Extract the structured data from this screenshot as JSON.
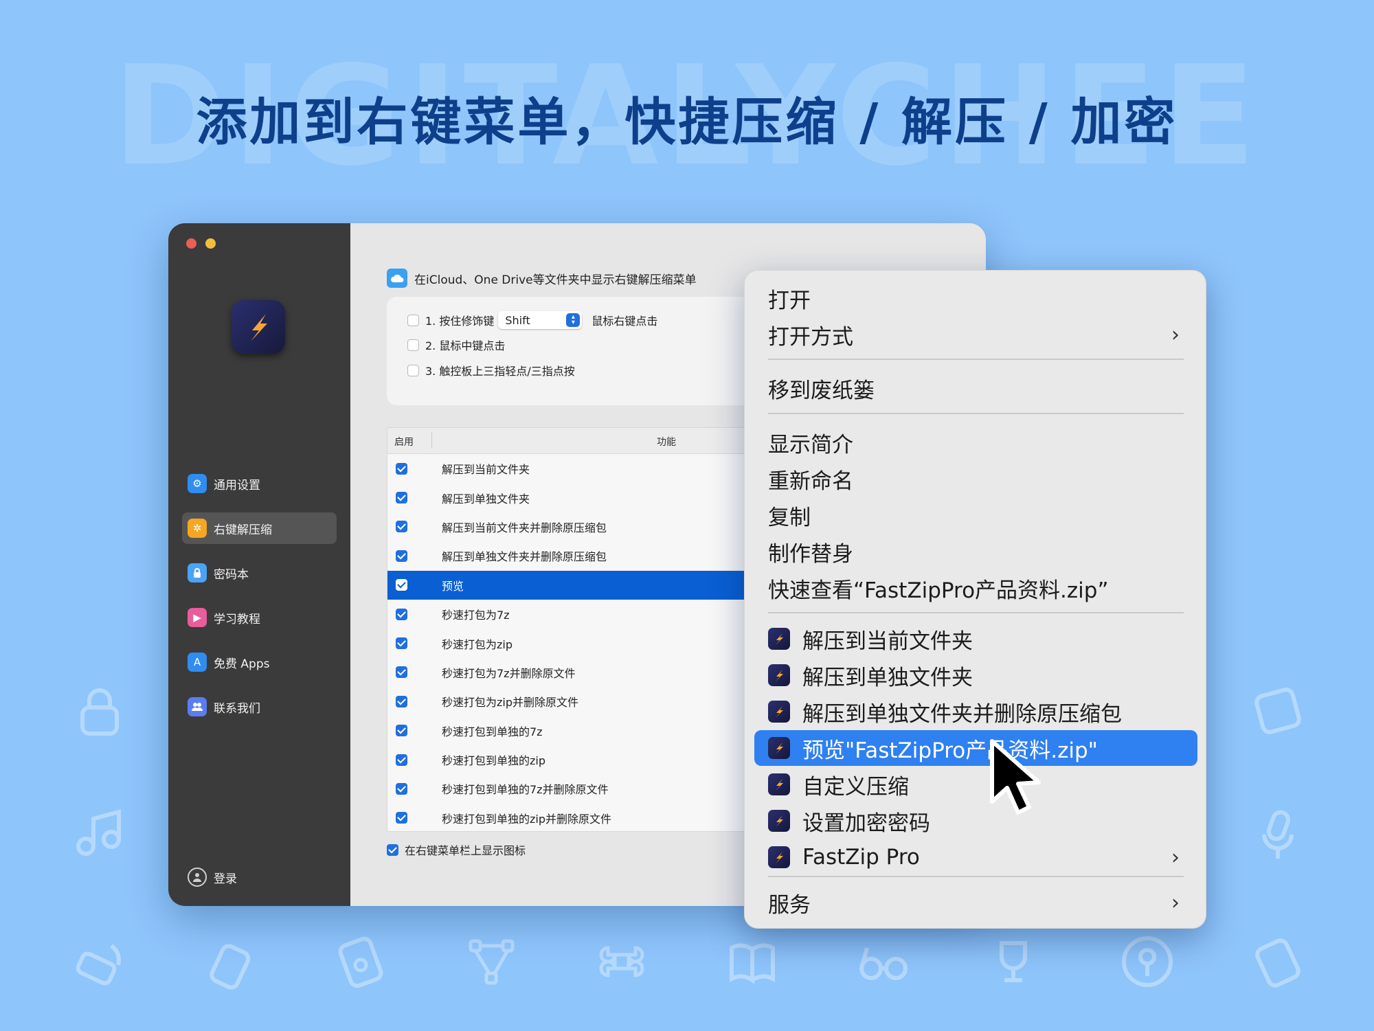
{
  "watermark": "DIGITALYCHEE",
  "headline": "添加到右键菜单，快捷压缩 / 解压 / 加密",
  "sidebar": {
    "items": [
      {
        "label": "通用设置",
        "icon": "gear-icon",
        "color": "#2f8cf0"
      },
      {
        "label": "右键解压缩",
        "icon": "sparkle-icon",
        "color": "#f5a623",
        "active": true
      },
      {
        "label": "密码本",
        "icon": "lock-icon",
        "color": "#4aa3f5"
      },
      {
        "label": "学习教程",
        "icon": "play-icon",
        "color": "#e85d9b"
      },
      {
        "label": "免费 Apps",
        "icon": "appstore-icon",
        "color": "#2f8cf0"
      },
      {
        "label": "联系我们",
        "icon": "people-icon",
        "color": "#5a7df0"
      }
    ],
    "login_label": "登录"
  },
  "content": {
    "cloud_label": "在iCloud、One Drive等文件夹中显示右键解压缩菜单",
    "options": [
      {
        "label": "1. 按住修饰键",
        "select_value": "Shift",
        "suffix": "鼠标右键点击",
        "checked": false
      },
      {
        "label": "2. 鼠标中键点击",
        "checked": false
      },
      {
        "label": "3. 触控板上三指轻点/三指点按",
        "checked": false
      }
    ],
    "table": {
      "col_enable": "启用",
      "col_function": "功能",
      "rows": [
        {
          "label": "解压到当前文件夹",
          "checked": true
        },
        {
          "label": "解压到单独文件夹",
          "checked": true
        },
        {
          "label": "解压到当前文件夹并删除原压缩包",
          "checked": true
        },
        {
          "label": "解压到单独文件夹并删除原压缩包",
          "checked": true
        },
        {
          "label": "预览",
          "checked": true,
          "selected": true
        },
        {
          "label": "秒速打包为7z",
          "checked": true
        },
        {
          "label": "秒速打包为zip",
          "checked": true
        },
        {
          "label": "秒速打包为7z并删除原文件",
          "checked": true
        },
        {
          "label": "秒速打包为zip并删除原文件",
          "checked": true
        },
        {
          "label": "秒速打包到单独的7z",
          "checked": true
        },
        {
          "label": "秒速打包到单独的zip",
          "checked": true
        },
        {
          "label": "秒速打包到单独的7z并删除原文件",
          "checked": true
        },
        {
          "label": "秒速打包到单独的zip并删除原文件",
          "checked": true
        }
      ]
    },
    "footer_label": "在右键菜单栏上显示图标"
  },
  "menu": {
    "open": "打开",
    "open_with": "打开方式",
    "trash": "移到废纸篓",
    "get_info": "显示简介",
    "rename": "重新命名",
    "copy": "复制",
    "alias": "制作替身",
    "quicklook": "快速查看“FastZipPro产品资料.zip”",
    "app_items": [
      "解压到当前文件夹",
      "解压到单独文件夹",
      "解压到单独文件夹并删除原压缩包",
      "预览\"FastZipPro产品资料.zip\"",
      "自定义压缩",
      "设置加密密码",
      "FastZip Pro"
    ],
    "services": "服务"
  }
}
